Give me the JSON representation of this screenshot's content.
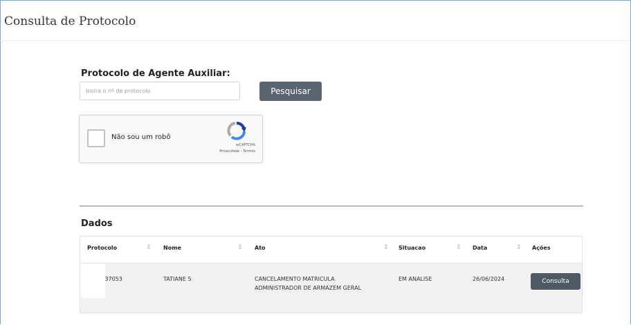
{
  "page": {
    "title": "Consulta de Protocolo"
  },
  "form": {
    "label": "Protocolo de Agente Auxiliar:",
    "input_placeholder": "Insira o nº de protocolo",
    "input_value": "",
    "search_button": "Pesquisar"
  },
  "captcha": {
    "label": "Não sou um robô",
    "brand": "reCAPTCHA",
    "links": "Privacidade - Termos",
    "checked": false
  },
  "results": {
    "title": "Dados",
    "columns": [
      "Protocolo",
      "Nome",
      "Ato",
      "Situacao",
      "Data",
      "Ações"
    ],
    "rows": [
      {
        "protocolo": "2400437053",
        "nome": "TATIANE S",
        "ato": "CANCELAMENTO MATRICULA ADMINISTRADOR DE ARMAZEM GERAL",
        "situacao": "EM ANALISE",
        "data": "26/06/2024",
        "acao": "Consulta"
      }
    ]
  },
  "colors": {
    "button_bg": "#5b6570",
    "frame_border": "#6fa8dc",
    "row_bg": "#f1f1f1"
  }
}
